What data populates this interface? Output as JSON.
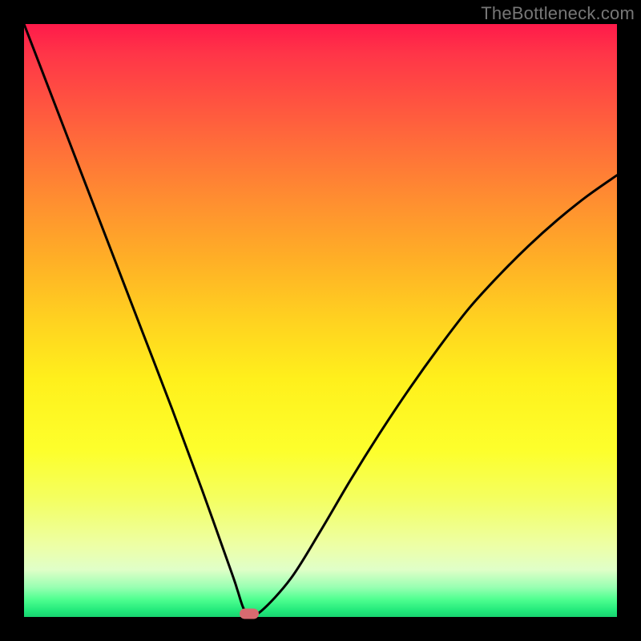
{
  "watermark": "TheBottleneck.com",
  "colors": {
    "background": "#000000",
    "gradient_top": "#ff1a4a",
    "gradient_bottom": "#18d270",
    "curve": "#000000",
    "marker": "#d86a70"
  },
  "chart_data": {
    "type": "line",
    "title": "",
    "xlabel": "",
    "ylabel": "",
    "xlim": [
      0,
      100
    ],
    "ylim": [
      0,
      100
    ],
    "grid": false,
    "legend": false,
    "annotations": [],
    "series": [
      {
        "name": "bottleneck-curve",
        "x": [
          0,
          5,
          10,
          15,
          20,
          25,
          30,
          35,
          36,
          37,
          38,
          40,
          45,
          50,
          55,
          60,
          65,
          70,
          75,
          80,
          85,
          90,
          95,
          100
        ],
        "values": [
          100,
          87,
          74,
          61,
          48,
          35,
          21.5,
          7.5,
          4.5,
          1.5,
          0.5,
          1.0,
          6.5,
          14.5,
          23,
          31,
          38.5,
          45.5,
          52,
          57.5,
          62.5,
          67,
          71,
          74.5
        ]
      }
    ],
    "marker": {
      "x": 38,
      "y": 0.5
    }
  }
}
